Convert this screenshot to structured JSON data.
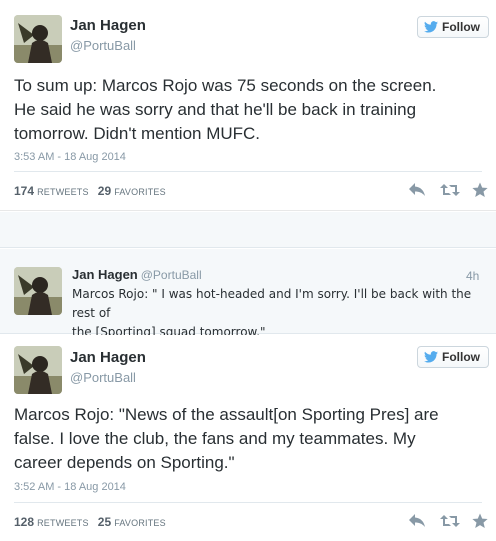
{
  "tweets": [
    {
      "author_name": "Jan Hagen",
      "author_handle": "@PortuBall",
      "follow_label": "Follow",
      "text_lines": [
        "To sum up: Marcos Rojo was 75 seconds on the screen.",
        "He said he was sorry and that he'll be back in training",
        "tomorrow. Didn't mention MUFC."
      ],
      "timestamp": "3:53 AM - 18 Aug 2014",
      "retweets": "174",
      "retweets_label": "RETWEETS",
      "favorites": "29",
      "favorites_label": "FAVORITES"
    },
    {
      "author_name": "Jan Hagen",
      "author_handle": "@PortuBall",
      "time_ago": "4h",
      "text_lines": [
        "Marcos Rojo: \" I was hot-headed and I'm sorry. I'll be back with the rest of",
        "the [Sporting] squad tomorrow.\""
      ]
    },
    {
      "author_name": "Jan Hagen",
      "author_handle": "@PortuBall",
      "follow_label": "Follow",
      "text_lines": [
        "Marcos Rojo: \"News of the assault[on Sporting Pres] are",
        "false. I love the club, the fans and my teammates. My",
        "career depends on Sporting.\""
      ],
      "timestamp": "3:52 AM - 18 Aug 2014",
      "retweets": "128",
      "retweets_label": "RETWEETS",
      "favorites": "25",
      "favorites_label": "FAVORITES"
    }
  ],
  "colors": {
    "twitter_blue": "#55acee",
    "icon_grey": "#8899a6",
    "text": "#292f33"
  },
  "icons": [
    "avatar",
    "twitter-bird-icon",
    "reply-icon",
    "retweet-icon",
    "favorite-star-icon"
  ]
}
